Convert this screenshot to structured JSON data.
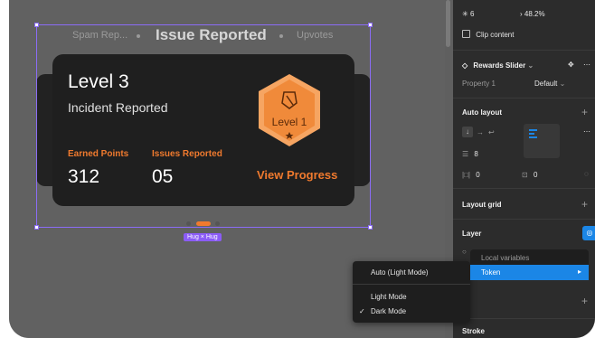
{
  "carousel": {
    "tab_left": "Spam Rep...",
    "tab_center": "Issue Reported",
    "tab_right": "Upvotes",
    "card": {
      "level": "Level 3",
      "subtitle": "Incident Reported",
      "stat1_label": "Earned Points",
      "stat1_value": "312",
      "stat2_label": "Issues Reported",
      "stat2_value": "05",
      "link": "View Progress",
      "badge_label": "Level 1"
    },
    "hug_label": "Hug × Hug"
  },
  "panel": {
    "top_value_left": "6",
    "top_value_right": "48.2%",
    "clip_content": "Clip content",
    "component_name": "Rewards Slider",
    "property_label": "Property 1",
    "property_value": "Default",
    "auto_layout": "Auto layout",
    "gap": "8",
    "padding_h": "0",
    "padding_v": "0",
    "layout_grid": "Layout grid",
    "layer": "Layer",
    "stroke": "Stroke"
  },
  "menu": {
    "items": [
      "Auto (Light Mode)",
      "Light Mode",
      "Dark Mode"
    ],
    "checked": "Dark Mode",
    "submenu_header": "Local variables",
    "submenu_item": "Token"
  },
  "colors": {
    "accent": "#f07a2e",
    "selection": "#8b6cf6",
    "menu_highlight": "#1b86e6"
  }
}
